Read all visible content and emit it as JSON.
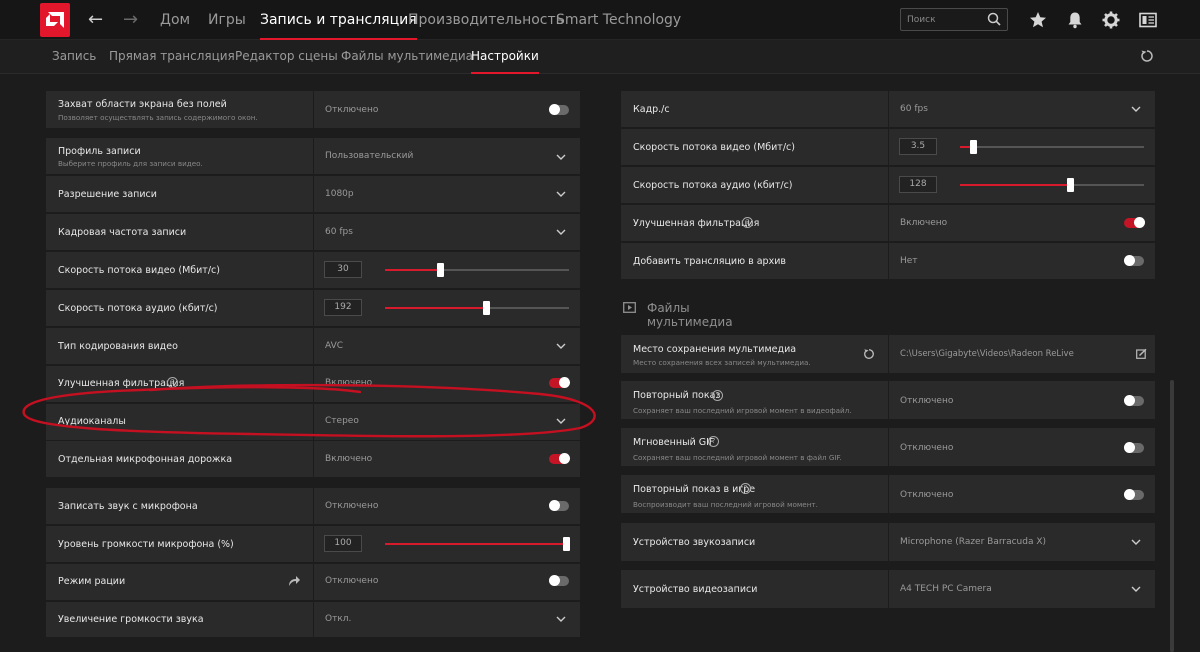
{
  "topbar": {
    "nav": [
      "Дом",
      "Игры",
      "Запись и трансляция",
      "Производительность",
      "Smart Technology"
    ],
    "search_placeholder": "Поиск",
    "icons": [
      "star-icon",
      "bell-icon",
      "gear-icon",
      "window-icon"
    ]
  },
  "subnav": {
    "tabs": [
      "Запись",
      "Прямая трансляция",
      "Редактор сцены",
      "Файлы мультимедиа",
      "Настройки"
    ]
  },
  "left": {
    "capture": {
      "label": "Захват области экрана без полей",
      "sub": "Позволяет осуществлять запись содержимого окон.",
      "value": "Отключено"
    },
    "profile": {
      "label": "Профиль записи",
      "sub": "Выберите профиль для записи видео.",
      "value": "Пользовательский"
    },
    "resolution": {
      "label": "Разрешение записи",
      "value": "1080p"
    },
    "framerate": {
      "label": "Кадровая частота записи",
      "value": "60 fps"
    },
    "video_bitrate": {
      "label": "Скорость потока видео (Мбит/с)",
      "value": "30",
      "level": 0.3
    },
    "audio_bitrate": {
      "label": "Скорость потока аудио (кбит/с)",
      "value": "192",
      "level": 0.55
    },
    "encoding": {
      "label": "Тип кодирования видео",
      "value": "AVC"
    },
    "filtering": {
      "label": "Улучшенная фильтрация",
      "value": "Включено"
    },
    "channels": {
      "label": "Аудиоканалы",
      "value": "Стерео"
    },
    "mic_track": {
      "label": "Отдельная микрофонная дорожка",
      "value": "Включено"
    },
    "mic_record": {
      "label": "Записать звук с микрофона",
      "value": "Отключено"
    },
    "mic_volume": {
      "label": "Уровень громкости микрофона (%)",
      "value": "100",
      "level": 1.0
    },
    "radio": {
      "label": "Режим рации",
      "value": "Отключено"
    },
    "boost": {
      "label": "Увеличение громкости звука",
      "value": "Откл."
    }
  },
  "right": {
    "fps": {
      "label": "Кадр./с",
      "value": "60 fps"
    },
    "video_bitrate": {
      "label": "Скорость потока видео (Мбит/с)",
      "value": "3.5",
      "level": 0.07
    },
    "audio_bitrate": {
      "label": "Скорость потока аудио (кбит/с)",
      "value": "128",
      "level": 0.6
    },
    "filtering": {
      "label": "Улучшенная фильтрация",
      "value": "Включено"
    },
    "archive": {
      "label": "Добавить трансляцию в архив",
      "value": "Нет"
    },
    "media_section": "Файлы мультимедиа",
    "save_path": {
      "label": "Место сохранения мультимедиа",
      "sub": "Место сохранения всех записей мультимедиа.",
      "value": "C:\\Users\\Gigabyte\\Videos\\Radeon ReLive"
    },
    "replay": {
      "label": "Повторный показ",
      "sub": "Сохраняет ваш последний игровой момент в видеофайл.",
      "value": "Отключено"
    },
    "gif": {
      "label": "Мгновенный GIF",
      "sub": "Сохраняет ваш последний игровой момент в файл GIF.",
      "value": "Отключено"
    },
    "ingame_replay": {
      "label": "Повторный показ в игре",
      "sub": "Воспроизводит ваш последний игровой момент.",
      "value": "Отключено"
    },
    "audio_device": {
      "label": "Устройство звукозаписи",
      "value": "Microphone (Razer Barracuda X)"
    },
    "video_device": {
      "label": "Устройство видеозаписи",
      "value": "A4 TECH PC Camera"
    }
  },
  "colors": {
    "accent": "#e3172c",
    "background": "#1c1c1c",
    "row": "#2a2a2a"
  }
}
